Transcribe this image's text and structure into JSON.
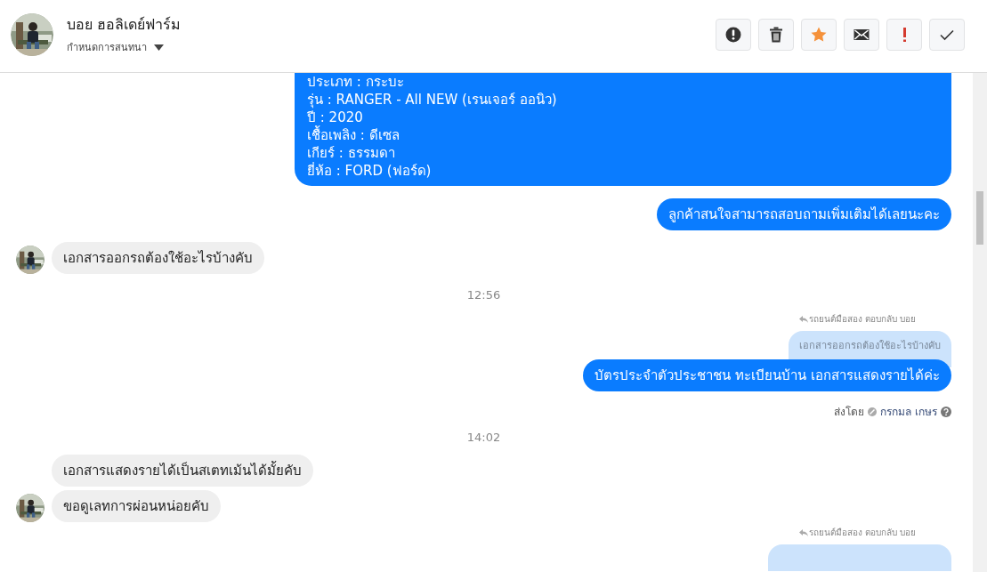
{
  "header": {
    "name": "บอย ฮอลิเดย์ฟาร์ม",
    "subtitle": "กำหนดการสนทนา"
  },
  "messages": [
    {
      "kind": "outgoing",
      "lines": [
        "ประเภท : กระบะ",
        "รุ่น : RANGER - All NEW (เรนเจอร์ ออนิว)",
        "ปี : 2020",
        "เชื้อเพลิง : ดีเซล",
        "เกียร์ : ธรรมดา",
        "ยี่ห้อ : FORD (ฟอร์ด)"
      ]
    },
    {
      "kind": "outgoing",
      "lines": [
        "ลูกค้าสนใจสามารถสอบถามเพิ่มเติมได้เลยนะคะ"
      ]
    },
    {
      "kind": "incoming",
      "text": "เอกสารออกรถต้องใช้อะไรบ้างคับ",
      "avatar": true
    },
    {
      "kind": "time",
      "text": "12:56"
    },
    {
      "kind": "reply",
      "label": "รถยนต์มือสอง ตอบกลับ บอย",
      "quote": "เอกสารออกรถต้องใช้อะไรบ้างคับ"
    },
    {
      "kind": "outgoing",
      "lines": [
        "บัตรประจำตัวประชาชน ทะเบียนบ้าน เอกสารแสดงรายได้ค่ะ"
      ],
      "sent_label": "ส่งโดย",
      "sender": "กรกมล เกษร"
    },
    {
      "kind": "time",
      "text": "14:02"
    },
    {
      "kind": "incoming",
      "text": "เอกสารแสดงรายได้เป็นสเตทเม้นได้มั้ยคับ",
      "avatar": false
    },
    {
      "kind": "incoming",
      "text": "ขอดูเลทการผ่อนหน่อยคับ",
      "avatar": true
    },
    {
      "kind": "reply",
      "label": "รถยนต์มือสอง ตอบกลับ บอย"
    }
  ]
}
